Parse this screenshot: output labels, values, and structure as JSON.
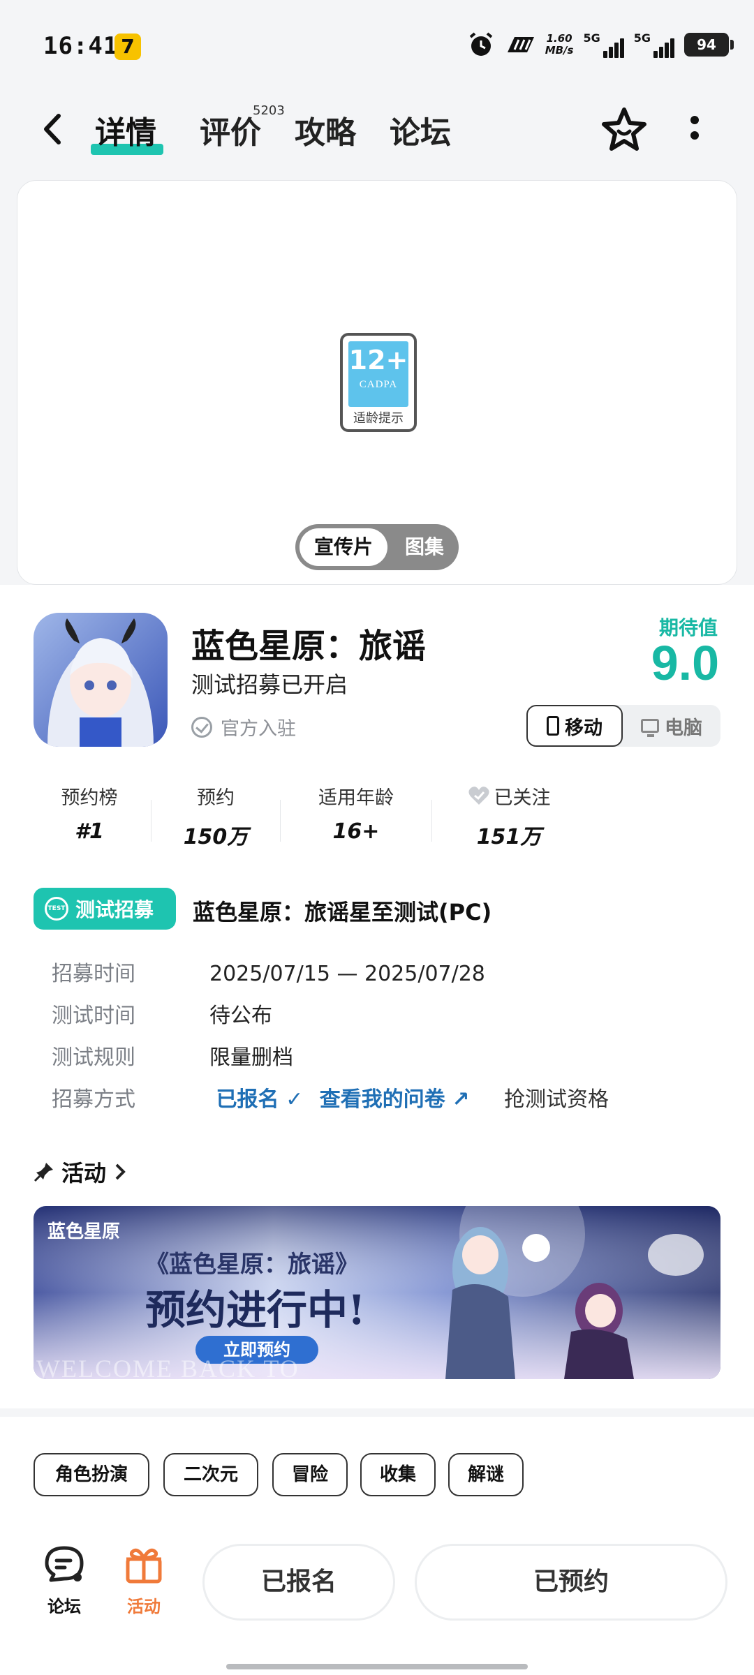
{
  "status_bar": {
    "time": "16:41",
    "speed_value": "1.60",
    "speed_unit": "MB/s",
    "net1": "5G",
    "net2": "5G",
    "battery": "94"
  },
  "nav": {
    "tabs": [
      {
        "label": "详情"
      },
      {
        "label": "评价"
      },
      {
        "label": "攻略"
      },
      {
        "label": "论坛"
      }
    ],
    "review_count": "5203"
  },
  "media": {
    "age_rating": "12+",
    "rating_org": "CADPA",
    "rating_tip": "适龄提示",
    "toggle_trailer": "宣传片",
    "toggle_gallery": "图集"
  },
  "game": {
    "title": "蓝色星原：旅谣",
    "subtitle": "测试招募已开启",
    "official": "官方入驻",
    "score_label": "期待值",
    "score": "9.0",
    "platform_mobile": "移动",
    "platform_pc": "电脑"
  },
  "stats": [
    {
      "label": "预约榜",
      "value": "#1"
    },
    {
      "label": "预约",
      "value": "150万"
    },
    {
      "label": "适用年龄",
      "value": "16+"
    },
    {
      "label": "已关注",
      "value": "151万"
    }
  ],
  "recruit": {
    "tag": "测试招募",
    "tag_icon_text": "TEST",
    "title": "蓝色星原：旅谣星至测试(PC)",
    "rows": [
      {
        "key": "招募时间",
        "value": "2025/07/15 — 2025/07/28"
      },
      {
        "key": "测试时间",
        "value": "待公布"
      },
      {
        "key": "测试规则",
        "value": "限量删档"
      },
      {
        "key": "招募方式"
      }
    ],
    "signed_up": "已报名",
    "view_survey": "查看我的问卷",
    "grab": "抢测试资格"
  },
  "activity": {
    "title": "活动",
    "banner_brand": "蓝色星原",
    "banner_sub": "《蓝色星原：旅谣》",
    "banner_main": "预约进行中!",
    "banner_btn": "立即预约",
    "banner_welcome": "WELCOME BACK TO"
  },
  "tags": [
    "角色扮演",
    "二次元",
    "冒险",
    "收集",
    "解谜"
  ],
  "bottom": {
    "forum": "论坛",
    "activity": "活动",
    "signed_up": "已报名",
    "reserved": "已预约"
  },
  "colors": {
    "accent": "#1ec4b0",
    "link": "#1f6fb5",
    "activity_orange": "#f07a3a"
  }
}
